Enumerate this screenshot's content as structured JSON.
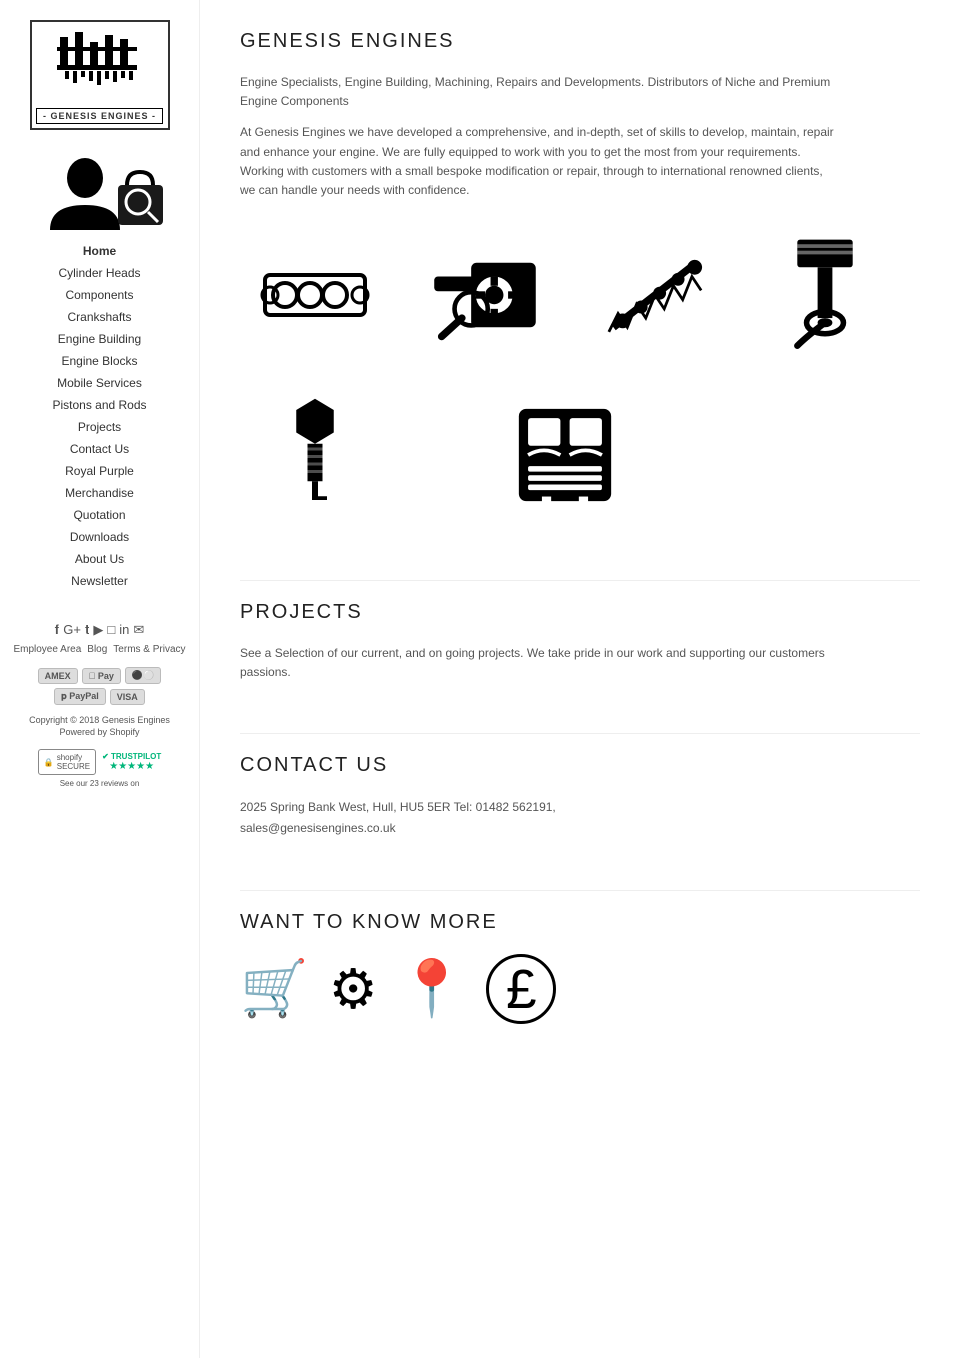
{
  "logo": {
    "text": "- GENESIS ENGINES -",
    "alt": "Genesis Engines Logo"
  },
  "nav": {
    "items": [
      {
        "label": "Home",
        "active": true
      },
      {
        "label": "Cylinder Heads",
        "active": false
      },
      {
        "label": "Components",
        "active": false
      },
      {
        "label": "Crankshafts",
        "active": false
      },
      {
        "label": "Engine Building",
        "active": false
      },
      {
        "label": "Engine Blocks",
        "active": false
      },
      {
        "label": "Mobile Services",
        "active": false
      },
      {
        "label": "Pistons and Rods",
        "active": false
      },
      {
        "label": "Projects",
        "active": false
      },
      {
        "label": "Contact Us",
        "active": false
      },
      {
        "label": "Royal Purple",
        "active": false
      },
      {
        "label": "Merchandise",
        "active": false
      },
      {
        "label": "Quotation",
        "active": false
      },
      {
        "label": "Downloads",
        "active": false
      },
      {
        "label": "About Us",
        "active": false
      },
      {
        "label": "Newsletter",
        "active": false
      }
    ]
  },
  "sidebar_links": [
    {
      "label": "Employee Area"
    },
    {
      "label": "Blog"
    },
    {
      "label": "Terms & Privacy"
    }
  ],
  "payment_methods": [
    "AMERICAN EXPRESS",
    "Apple Pay",
    "MasterCard",
    "PayPal",
    "VISA"
  ],
  "copyright": "Copyright © 2018 Genesis Engines",
  "powered_by": "Powered by Shopify",
  "see_reviews": "See our 23 reviews on",
  "social_icons": [
    "f",
    "G+",
    "t",
    "yt",
    "ig",
    "in"
  ],
  "sections": {
    "home": {
      "title": "GENESIS ENGINES",
      "tagline": "Engine Specialists, Engine Building, Machining, Repairs and Developments. Distributors of Niche and Premium Engine Components",
      "description": "At Genesis Engines we have developed a comprehensive, and in-depth, set of skills to develop, maintain, repair and enhance your engine. We are fully equipped to work with you to get the most from your requirements. Working with customers with a small bespoke modification or repair, through to international renowned clients, we can handle your needs with confidence."
    },
    "projects": {
      "title": "PROJECTS",
      "description": "See a Selection of our current, and on going projects. We take pride in our work and supporting our customers passions."
    },
    "contact": {
      "title": "CONTACT US",
      "address": "2025 Spring Bank West, Hull, HU5 5ER  Tel: 01482 562191,",
      "email": "sales@genesisengines.co.uk"
    },
    "want_more": {
      "title": "WANT TO KNOW MORE"
    }
  }
}
